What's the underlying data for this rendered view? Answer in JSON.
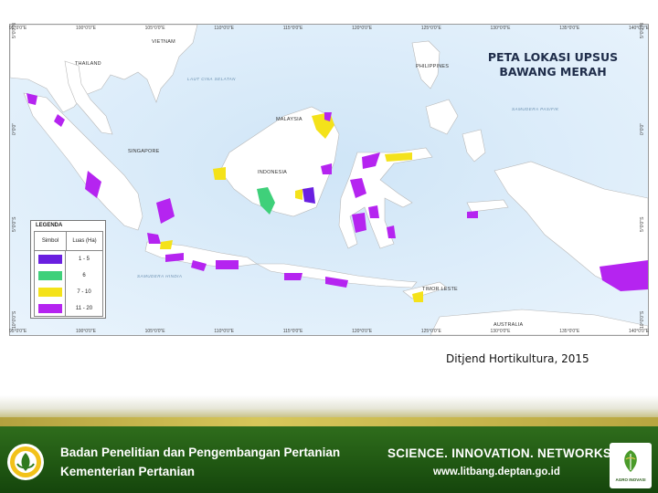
{
  "map": {
    "title_line1": "PETA LOKASI UPSUS",
    "title_line2": "BAWANG MERAH",
    "ticks_top": [
      "95°0'0\"E",
      "100°0'0\"E",
      "105°0'0\"E",
      "110°0'0\"E",
      "115°0'0\"E",
      "120°0'0\"E",
      "125°0'0\"E",
      "130°0'0\"E",
      "135°0'0\"E",
      "140°0'0\"E"
    ],
    "ticks_bottom": [
      "95°0'0\"E",
      "100°0'0\"E",
      "105°0'0\"E",
      "110°0'0\"E",
      "115°0'0\"E",
      "120°0'0\"E",
      "125°0'0\"E",
      "130°0'0\"E",
      "135°0'0\"E",
      "140°0'0\"E"
    ],
    "ticks_left": [
      "5°0'0\"N",
      "0°0'0\"",
      "5°0'0\"S",
      "10°0'0\"S"
    ],
    "ticks_right": [
      "5°0'0\"N",
      "0°0'0\"",
      "5°0'0\"S",
      "10°0'0\"S"
    ],
    "countries": {
      "thailand": "THAILAND",
      "vietnam": "VIETNAM",
      "philippines": "PHILIPPINES",
      "malaysia": "MALAYSIA",
      "singapore": "SINGAPORE",
      "indonesia": "INDONESIA",
      "timor_leste": "TIMOR LESTE",
      "australia": "AUSTRALIA"
    },
    "seas": {
      "south_china_sea": "LAUT CINA SELATAN",
      "pacific": "SAMUDERA PASIFIK",
      "indian_ocean": "SAMUDERA HINDIA"
    },
    "colors": {
      "sea": "#dfeefa",
      "land": "#ffffff",
      "class_1_5": "#6a1fe0",
      "class_6": "#3fd07a",
      "class_7_10": "#f4e21a",
      "class_11_20": "#b524f0"
    }
  },
  "legend": {
    "title": "LEGENDA",
    "col_symbol": "Simbol",
    "col_value": "Luas (Ha)",
    "rows": [
      {
        "value": "1 - 5",
        "color": "#6a1fe0"
      },
      {
        "value": "6",
        "color": "#3fd07a"
      },
      {
        "value": "7 - 10",
        "color": "#f4e21a"
      },
      {
        "value": "11 - 20",
        "color": "#b524f0"
      }
    ]
  },
  "credit": "Ditjend Hortikultura, 2015",
  "footer": {
    "org_line1": "Badan Penelitian dan Pengembangan Pertanian",
    "org_line2": "Kementerian Pertanian",
    "tagline": "SCIENCE. INNOVATION. NETWORKS",
    "url": "www.litbang.deptan.go.id",
    "logo_right_text": "AGRO INOVASI"
  }
}
